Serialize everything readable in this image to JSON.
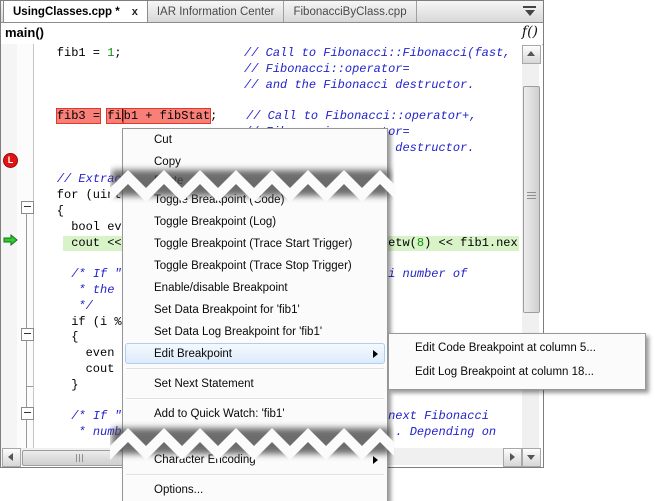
{
  "window": {
    "tabs": [
      {
        "label": "UsingClasses.cpp *",
        "close_label": "x",
        "active": true
      },
      {
        "label": "IAR Information Center",
        "active": false
      },
      {
        "label": "FibonacciByClass.cpp",
        "active": false
      }
    ],
    "function_bar": {
      "scope_label": "main()",
      "function_selector_label": "f()"
    }
  },
  "editor": {
    "log_breakpoint_badge": "L",
    "lines": [
      {
        "segs": [
          [
            "    fib1 = ",
            "k"
          ],
          [
            "1",
            "n"
          ],
          [
            ";",
            "k"
          ],
          [
            "                 ",
            "k"
          ],
          [
            "// Call to Fibonacci::Fibonacci(fast,",
            "c"
          ]
        ]
      },
      {
        "segs": [
          [
            "                              ",
            "k"
          ],
          [
            "// Fibonacci::operator=",
            "c"
          ]
        ]
      },
      {
        "segs": [
          [
            "                              ",
            "k"
          ],
          [
            "// and the Fibonacci destructor.",
            "c"
          ]
        ]
      },
      {
        "segs": []
      },
      {
        "segs": [
          [
            "    ",
            "k"
          ],
          [
            "fib3 =",
            "r"
          ],
          [
            " ",
            "k"
          ],
          [
            "fi",
            "r"
          ],
          [
            "CARET",
            "caret"
          ],
          [
            "b1 + fibStat",
            "r"
          ],
          [
            ";",
            "k"
          ],
          [
            "    ",
            "k"
          ],
          [
            "// Call to Fibonacci::operator+,",
            "c"
          ]
        ]
      },
      {
        "segs": [
          [
            "                              ",
            "k"
          ],
          [
            "// Fibonacci::operator=",
            "c"
          ]
        ]
      },
      {
        "segs": [
          [
            "                              ",
            "k"
          ],
          [
            "// and the Fibonacci destructor.",
            "c"
          ]
        ]
      },
      {
        "segs": []
      },
      {
        "segs": [
          [
            "    ",
            "k"
          ],
          [
            "// Extrac",
            "c"
          ]
        ]
      },
      {
        "segs": [
          [
            "    for (uint",
            "k"
          ]
        ]
      },
      {
        "segs": [
          [
            "    {",
            "k"
          ]
        ]
      },
      {
        "segs": [
          [
            "      bool eve",
            "k"
          ]
        ]
      },
      {
        "segs": [
          [
            "      cout << ",
            "k"
          ],
          [
            "                                   ",
            "k"
          ],
          [
            "setw(",
            "k"
          ],
          [
            "8",
            "n"
          ],
          [
            ") << fib1.nex",
            "k"
          ]
        ],
        "hl": "green"
      },
      {
        "segs": []
      },
      {
        "segs": [
          [
            "      ",
            "k"
          ],
          [
            "/* If \"",
            "c"
          ],
          [
            "                                     ",
            "c"
          ],
          [
            "i number of",
            "c"
          ]
        ]
      },
      {
        "segs": [
          [
            "       ",
            "k"
          ],
          [
            "* the ",
            "c"
          ]
        ]
      },
      {
        "segs": [
          [
            "       ",
            "k"
          ],
          [
            "*/",
            "c"
          ]
        ]
      },
      {
        "segs": [
          [
            "      if (i %",
            "k"
          ]
        ]
      },
      {
        "segs": [
          [
            "      {",
            "k"
          ]
        ]
      },
      {
        "segs": [
          [
            "        even ",
            "k"
          ]
        ]
      },
      {
        "segs": [
          [
            "        cout ",
            "k"
          ]
        ]
      },
      {
        "segs": [
          [
            "      }",
            "k"
          ]
        ]
      },
      {
        "segs": []
      },
      {
        "segs": [
          [
            "      ",
            "k"
          ],
          [
            "/* If \"",
            "c"
          ],
          [
            "                                     ",
            "c"
          ],
          [
            "next Fibonacci",
            "c"
          ]
        ]
      },
      {
        "segs": [
          [
            "       ",
            "k"
          ],
          [
            "* numb",
            "c"
          ],
          [
            "                                      ",
            "c"
          ],
          [
            ". Depending on",
            "c"
          ]
        ]
      }
    ]
  },
  "context_menu": {
    "items": [
      {
        "label": "Cut"
      },
      {
        "label": "Copy"
      },
      {
        "label": "Paste",
        "short": true
      },
      {
        "label": "Toggle Breakpoint (Code)"
      },
      {
        "label": "Toggle Breakpoint (Log)"
      },
      {
        "label": "Toggle Breakpoint (Trace Start Trigger)"
      },
      {
        "label": "Toggle Breakpoint (Trace Stop Trigger)"
      },
      {
        "label": "Enable/disable Breakpoint"
      },
      {
        "label": "Set Data Breakpoint for 'fib1'"
      },
      {
        "label": "Set Data Log Breakpoint for 'fib1'"
      },
      {
        "label": "Edit Breakpoint",
        "submenu": true,
        "selected": true
      },
      {
        "separator": true
      },
      {
        "label": "Set Next Statement"
      },
      {
        "separator": true
      },
      {
        "label": "Add to Quick Watch:  'fib1'"
      },
      {
        "tear": true
      },
      {
        "label": "Character Encoding",
        "submenu": true
      },
      {
        "separator": true
      },
      {
        "label": "Options..."
      }
    ]
  },
  "submenu": {
    "items": [
      {
        "label": "Edit Code Breakpoint at column 5..."
      },
      {
        "label": "Edit Log Breakpoint at column 18..."
      }
    ]
  },
  "colors": {
    "comment": "#2222cc",
    "number": "#0f8f0f",
    "breakpoint_highlight": "#f88078",
    "execution_highlight": "#d9f3c9",
    "log_badge": "#e01414",
    "execution_arrow": "#2ecc2e",
    "menu_selection": "#dcebfb"
  }
}
